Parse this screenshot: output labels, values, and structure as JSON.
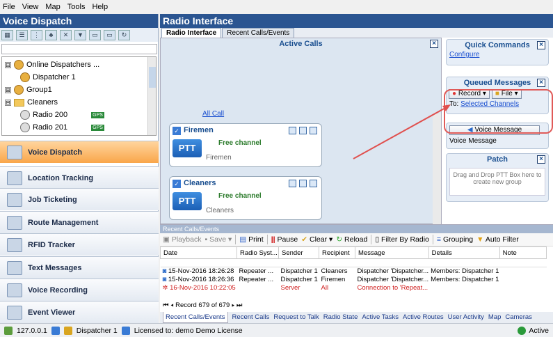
{
  "menu": [
    "File",
    "View",
    "Map",
    "Tools",
    "Help"
  ],
  "left": {
    "title": "Voice Dispatch",
    "tree": [
      {
        "label": "Online Dispatchers ...",
        "toggle": "⊟"
      },
      {
        "label": "Dispatcher 1",
        "toggle": ""
      },
      {
        "label": "Group1",
        "toggle": "⊞"
      },
      {
        "label": "Cleaners",
        "toggle": "⊟"
      },
      {
        "label": "Radio 200",
        "toggle": ""
      },
      {
        "label": "Radio 201",
        "toggle": ""
      }
    ],
    "badge": "GPS",
    "nav": [
      "Voice Dispatch",
      "Location Tracking",
      "Job Ticketing",
      "Route Management",
      "RFID Tracker",
      "Text Messages",
      "Voice Recording",
      "Event Viewer"
    ]
  },
  "right": {
    "title": "Radio Interface",
    "tabs": [
      "Radio Interface",
      "Recent Calls/Events"
    ],
    "active_calls": "Active Calls",
    "allcall": "All Call",
    "cards": [
      {
        "name": "Firemen",
        "status": "Free channel",
        "sub": "Firemen",
        "ptt": "PTT"
      },
      {
        "name": "Cleaners",
        "status": "Free channel",
        "sub": "Cleaners",
        "ptt": "PTT"
      }
    ],
    "quick": {
      "title": "Quick Commands",
      "link": "Configure"
    },
    "queued": {
      "title": "Queued Messages",
      "record": "Record",
      "file": "File",
      "to": "To:",
      "channels": "Selected Channels"
    },
    "voice": {
      "button": "Voice Message",
      "label": "Voice Message"
    },
    "patch": {
      "title": "Patch",
      "hint": "Drag and Drop PTT Box here to create new group"
    }
  },
  "recent": {
    "header": "Recent Calls/Events",
    "toolbar": [
      "Playback",
      "Save",
      "Print",
      "Pause",
      "Clear",
      "Reload",
      "Filter By Radio",
      "Grouping",
      "Auto Filter"
    ],
    "columns": [
      "Date",
      "Radio Syst...",
      "Sender",
      "Recipient",
      "Message",
      "Details",
      "Note"
    ],
    "rows": [
      [
        "15-Nov-2016 18:26:28",
        "Repeater ...",
        "Dispatcher 1",
        "Cleaners",
        "Dispatcher 'Dispatcher...",
        "Members: Dispatcher 1",
        ""
      ],
      [
        "15-Nov-2016 18:26:36",
        "Repeater ...",
        "Dispatcher 1",
        "Firemen",
        "Dispatcher 'Dispatcher...",
        "Members: Dispatcher 1",
        ""
      ],
      [
        "16-Nov-2016 10:22:05",
        "",
        "Server",
        "All",
        "Connection to 'Repeat...",
        "",
        ""
      ]
    ],
    "pager": "Record 679 of 679",
    "tabs": [
      "Recent Calls/Events",
      "Recent Calls",
      "Request to Talk",
      "Radio State",
      "Active Tasks",
      "Active Routes",
      "User Activity",
      "Map",
      "Cameras"
    ]
  },
  "status": {
    "ip": "127.0.0.1",
    "user": "Dispatcher 1",
    "license": "Licensed to: demo Demo License",
    "state": "Active"
  }
}
